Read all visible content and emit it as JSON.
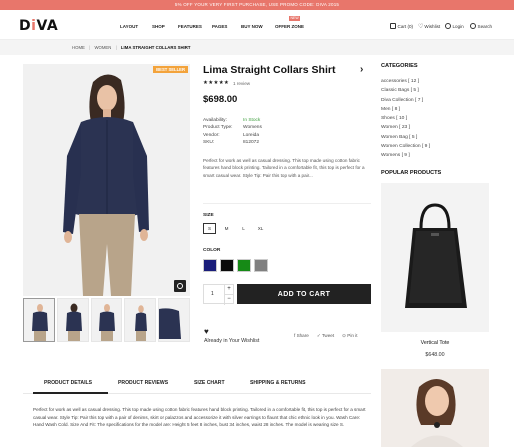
{
  "promo": {
    "text": "5% OFF YOUR VERY FIRST PURCHASE, USE PROMO CODE: DIVA 2015"
  },
  "header": {
    "logo_pre": "D",
    "logo_i": "i",
    "logo_post": "VA",
    "nav": [
      {
        "label": "LAYOUT"
      },
      {
        "label": "SHOP"
      },
      {
        "label": "FEATURES"
      },
      {
        "label": "PAGES"
      },
      {
        "label": "BUY NOW"
      },
      {
        "label": "OFFER ZONE"
      }
    ],
    "new_badge": "NEW",
    "cart": "Cart (0)",
    "wishlist": "Wishlist",
    "login": "Login",
    "search": "Search"
  },
  "breadcrumb": {
    "home": "HOME",
    "sep1": "|",
    "section": "WOMEN",
    "sep2": "|",
    "current": "LIMA STRAIGHT COLLARS SHIRT"
  },
  "product": {
    "badge": "BEST SELLER",
    "title": "Lima Straight Collars Shirt",
    "stars": "★★★★★",
    "reviews": "1 review",
    "price": "$698.00",
    "info": [
      {
        "k": "Availability:",
        "v": "In Stock"
      },
      {
        "k": "Product Type:",
        "v": "Womens"
      },
      {
        "k": "Vendor:",
        "v": "Loreida"
      },
      {
        "k": "SKU:",
        "v": "812072"
      }
    ],
    "description": "Perfect for work as well as casual dressing. This top made using cotton fabric features hand block printing. Tailored in a comfortable fit, this top is perfect for a smart casual wear. Style Tip: Pair this top with a pair...",
    "size_label": "SIZE",
    "sizes": [
      "S",
      "M",
      "L",
      "XL"
    ],
    "color_label": "COLOR",
    "colors": [
      "#1a1d7a",
      "#0b0b0b",
      "#168a16",
      "#808080"
    ],
    "qty": "1",
    "qty_plus": "+",
    "qty_minus": "−",
    "add_to_cart": "ADD TO CART",
    "wishlist": "Already in Your Wishlist",
    "shares": [
      "Share",
      "Tweet",
      "Pin it"
    ]
  },
  "sidebar": {
    "categories_title": "CATEGORIES",
    "categories": [
      "accessories [ 12 ]",
      "Classic Bags [ 5 ]",
      "Diva Collection [ 7 ]",
      "Men [ 8 ]",
      "Shoes [ 10 ]",
      "Women [ 23 ]",
      "Women Bag [ 5 ]",
      "Women Collection [ 9 ]",
      "Womens [ 9 ]"
    ],
    "popular_title": "POPULAR PRODUCTS",
    "popular_name": "Vertical Tote",
    "popular_price": "$648.00"
  },
  "tabs": [
    {
      "label": "PRODUCT DETAILS"
    },
    {
      "label": "PRODUCT REVIEWS"
    },
    {
      "label": "SIZE CHART"
    },
    {
      "label": "SHIPPING & RETURNS"
    }
  ],
  "details": "Perfect for work as well as casual dressing. This top made using cotton fabric features hand block printing. Tailored in a comfortable fit, this top is perfect for a smart casual wear. Style Tip: Pair this top with a pair of denims, skirt or palazzos and accessorize it with silver earrings to flaunt that chic ethnic look in you. Wash Care: Hand Wash Cold. Size And Fit: The specifications for the model are: Height 5 feet 8 inches, bust 34 inches, waist 28 inches. The model is wearing size S."
}
